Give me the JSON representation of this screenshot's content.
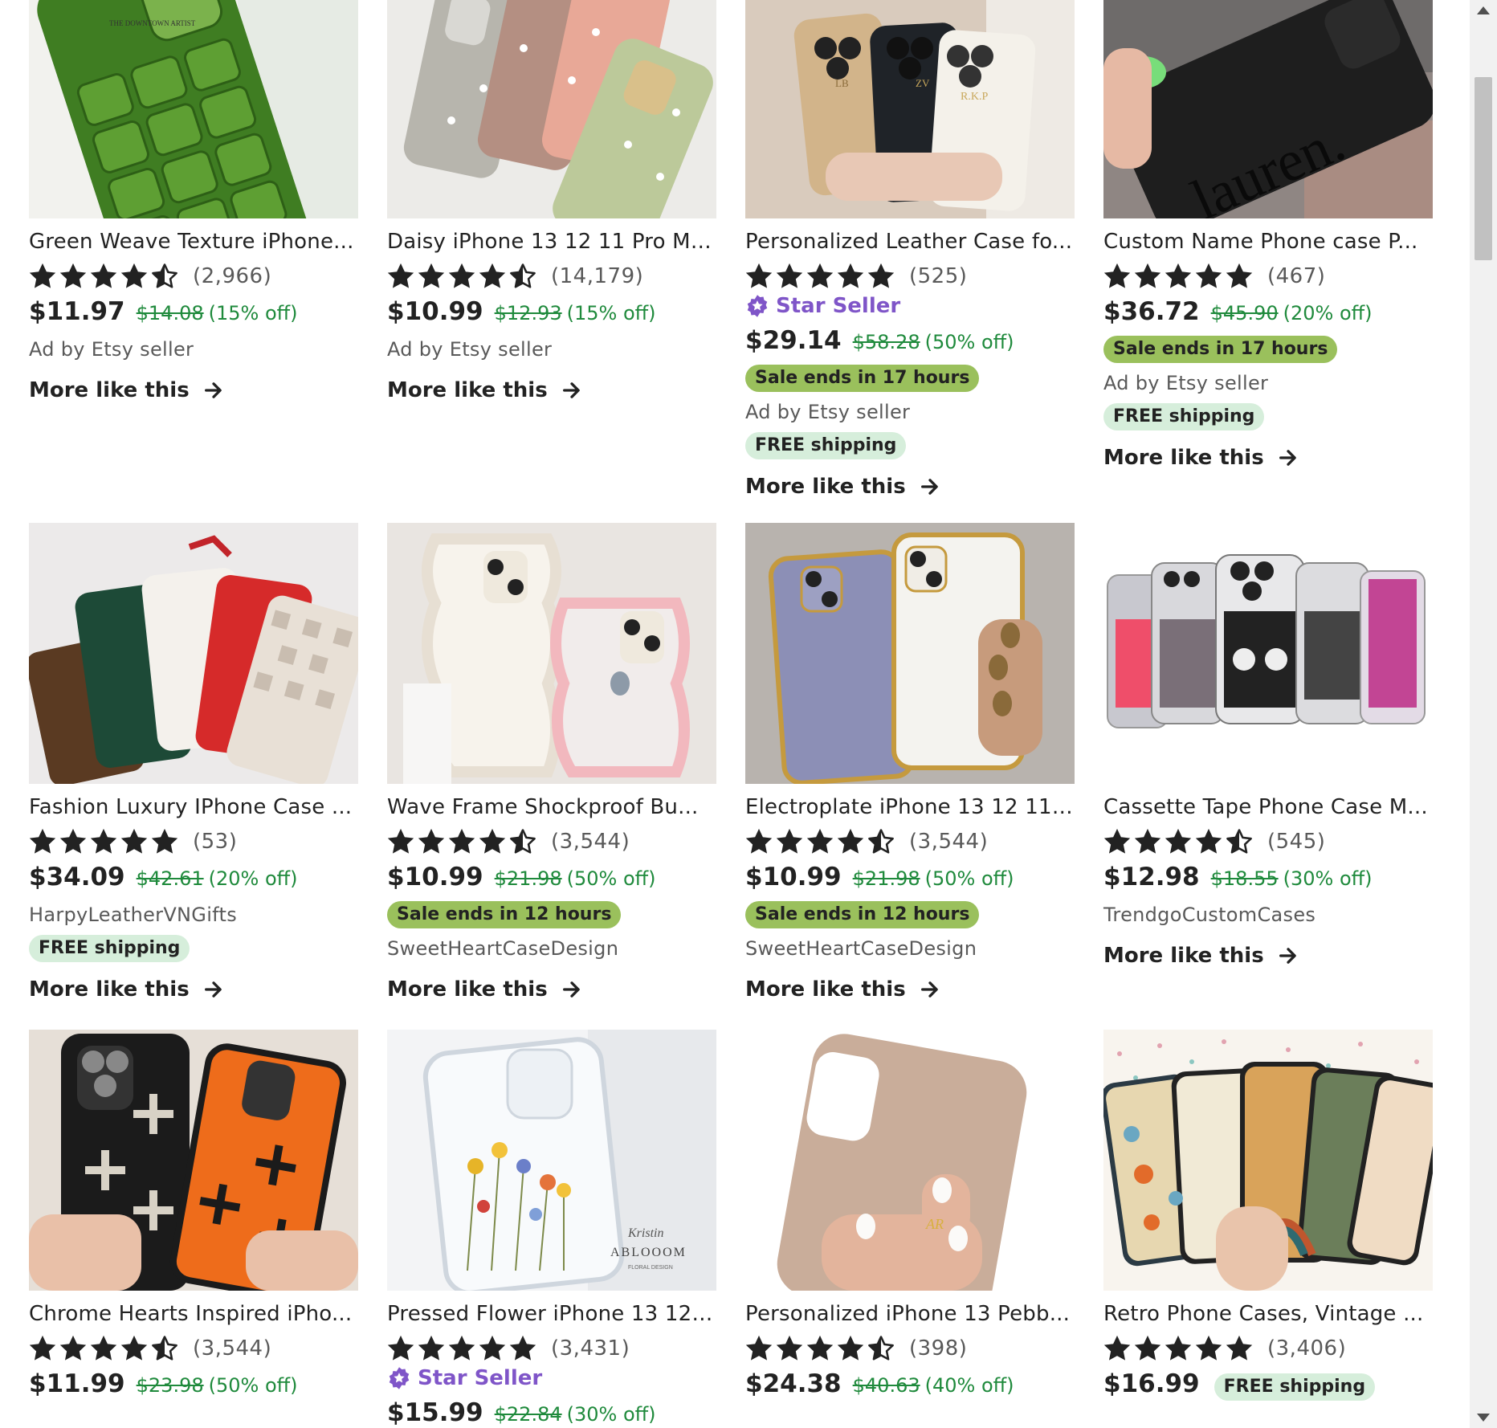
{
  "colors": {
    "sale_pill": "#9ac05c",
    "free_shipping_pill": "#d6eedb",
    "discount_green": "#1f8a3c",
    "star_seller_purple": "#7f55c8",
    "star": "#222222"
  },
  "icons": {
    "star": "star-icon",
    "half_star": "half-star-icon",
    "arrow": "arrow-right-icon",
    "star_seller": "star-seller-badge-icon"
  },
  "listings": [
    {
      "title": "Green Weave Texture iPhone...",
      "rating": 4.5,
      "reviews": "(2,966)",
      "price": "$11.97",
      "orig": "$14.08",
      "off": "(15% off)",
      "ad": "Ad by Etsy seller",
      "more": "More like this"
    },
    {
      "title": "Daisy iPhone 13 12 11 Pro Max...",
      "rating": 4.5,
      "reviews": "(14,179)",
      "price": "$10.99",
      "orig": "$12.93",
      "off": "(15% off)",
      "ad": "Ad by Etsy seller",
      "more": "More like this"
    },
    {
      "title": "Personalized Leather Case fo...",
      "rating": 5,
      "reviews": "(525)",
      "star_seller": "Star Seller",
      "price": "$29.14",
      "orig": "$58.28",
      "off": "(50% off)",
      "sale": "Sale ends in 17 hours",
      "ad": "Ad by Etsy seller",
      "shipping": "FREE shipping",
      "more": "More like this"
    },
    {
      "title": "Custom Name Phone case P...",
      "rating": 5,
      "reviews": "(467)",
      "price": "$36.72",
      "orig": "$45.90",
      "off": "(20% off)",
      "sale": "Sale ends in 17 hours",
      "ad": "Ad by Etsy seller",
      "shipping": "FREE shipping",
      "more": "More like this"
    },
    {
      "title": "Fashion Luxury IPhone Case ...",
      "rating": 5,
      "reviews": "(53)",
      "price": "$34.09",
      "orig": "$42.61",
      "off": "(20% off)",
      "seller": "HarpyLeatherVNGifts",
      "shipping": "FREE shipping",
      "more": "More like this"
    },
    {
      "title": "Wave Frame Shockproof Bu...",
      "rating": 4.5,
      "reviews": "(3,544)",
      "price": "$10.99",
      "orig": "$21.98",
      "off": "(50% off)",
      "sale": "Sale ends in 12 hours",
      "seller": "SweetHeartCaseDesign",
      "more": "More like this"
    },
    {
      "title": "Electroplate iPhone 13 12 11 P...",
      "rating": 4.5,
      "reviews": "(3,544)",
      "price": "$10.99",
      "orig": "$21.98",
      "off": "(50% off)",
      "sale": "Sale ends in 12 hours",
      "seller": "SweetHeartCaseDesign",
      "more": "More like this"
    },
    {
      "title": "Cassette Tape Phone Case M...",
      "rating": 4.5,
      "reviews": "(545)",
      "price": "$12.98",
      "orig": "$18.55",
      "off": "(30% off)",
      "seller": "TrendgoCustomCases",
      "more": "More like this"
    },
    {
      "title": "Chrome Hearts Inspired iPho...",
      "rating": 4.5,
      "reviews": "(3,544)",
      "price": "$11.99",
      "orig": "$23.98",
      "off": "(50% off)"
    },
    {
      "title": "Pressed Flower iPhone 13 12 ...",
      "rating": 5,
      "reviews": "(3,431)",
      "star_seller": "Star Seller",
      "price": "$15.99",
      "orig": "$22.84",
      "off": "(30% off)"
    },
    {
      "title": "Personalized iPhone 13 Pebb...",
      "rating": 4.5,
      "reviews": "(398)",
      "price": "$24.38",
      "orig": "$40.63",
      "off": "(40% off)"
    },
    {
      "title": "Retro Phone Cases, Vintage ...",
      "rating": 5,
      "reviews": "(3,406)",
      "price": "$16.99",
      "shipping_inline": "FREE shipping"
    }
  ],
  "image_text": {
    "caption_0": "THE DOWNTOWN ARTIST",
    "mono_2a": "LB",
    "mono_2b": "ZV",
    "mono_2c": "R.K.P",
    "name_3": "lauren.",
    "brand_9a": "Kristin",
    "brand_9b": "ABLOOOM",
    "brand_9c": "FLORAL DESIGN",
    "mono_10": "AR"
  }
}
